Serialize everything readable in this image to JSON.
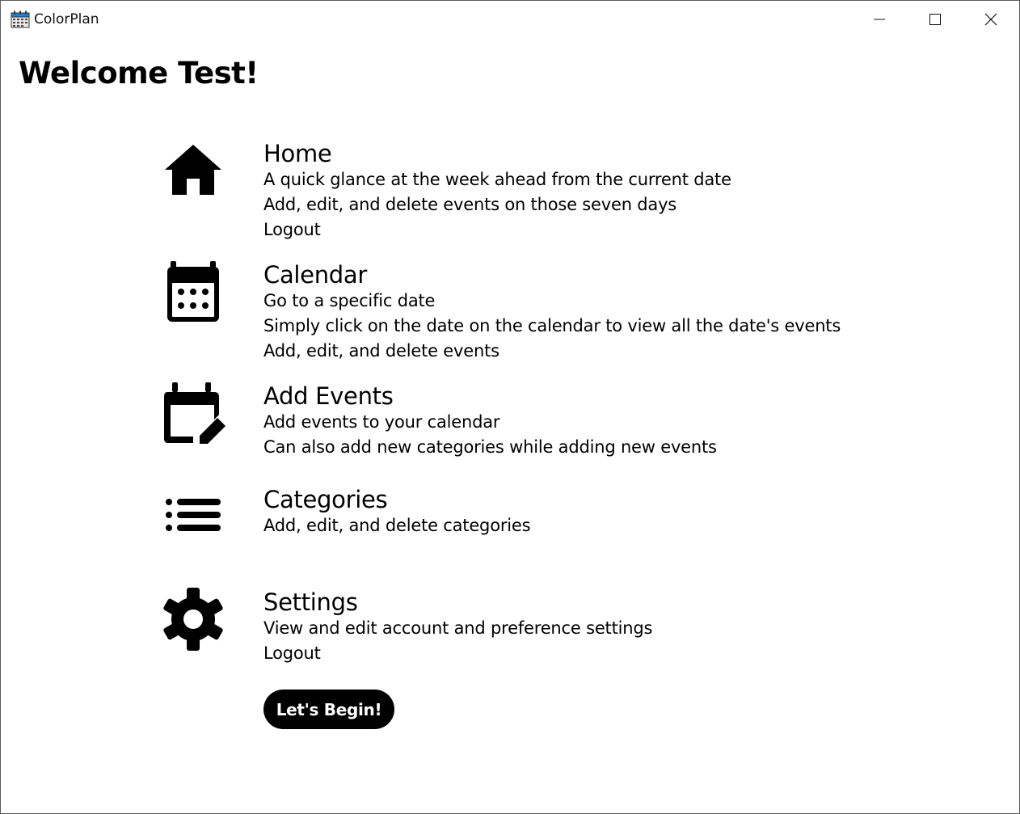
{
  "window": {
    "title": "ColorPlan",
    "icon": "calendar-app-icon",
    "controls": {
      "minimize": "minimize-icon",
      "maximize": "maximize-icon",
      "close": "close-icon"
    }
  },
  "welcome": "Welcome Test!",
  "sections": {
    "home": {
      "icon": "home-icon",
      "title": "Home",
      "lines": [
        "A quick glance at the week ahead from the current date",
        "Add, edit, and delete events on those seven days",
        "Logout"
      ]
    },
    "calendar": {
      "icon": "calendar-icon",
      "title": "Calendar",
      "lines": [
        "Go to a specific date",
        "Simply click on the date on the calendar to view all the date's events",
        "Add, edit, and delete events"
      ]
    },
    "add_events": {
      "icon": "edit-calendar-icon",
      "title": "Add Events",
      "lines": [
        "Add events to your calendar",
        "Can also add new categories while adding new events"
      ]
    },
    "categories": {
      "icon": "list-icon",
      "title": "Categories",
      "lines": [
        "Add, edit, and delete categories"
      ]
    },
    "settings": {
      "icon": "gear-icon",
      "title": "Settings",
      "lines": [
        "View and edit account and preference settings",
        "Logout"
      ]
    }
  },
  "begin_button": "Let's Begin!"
}
